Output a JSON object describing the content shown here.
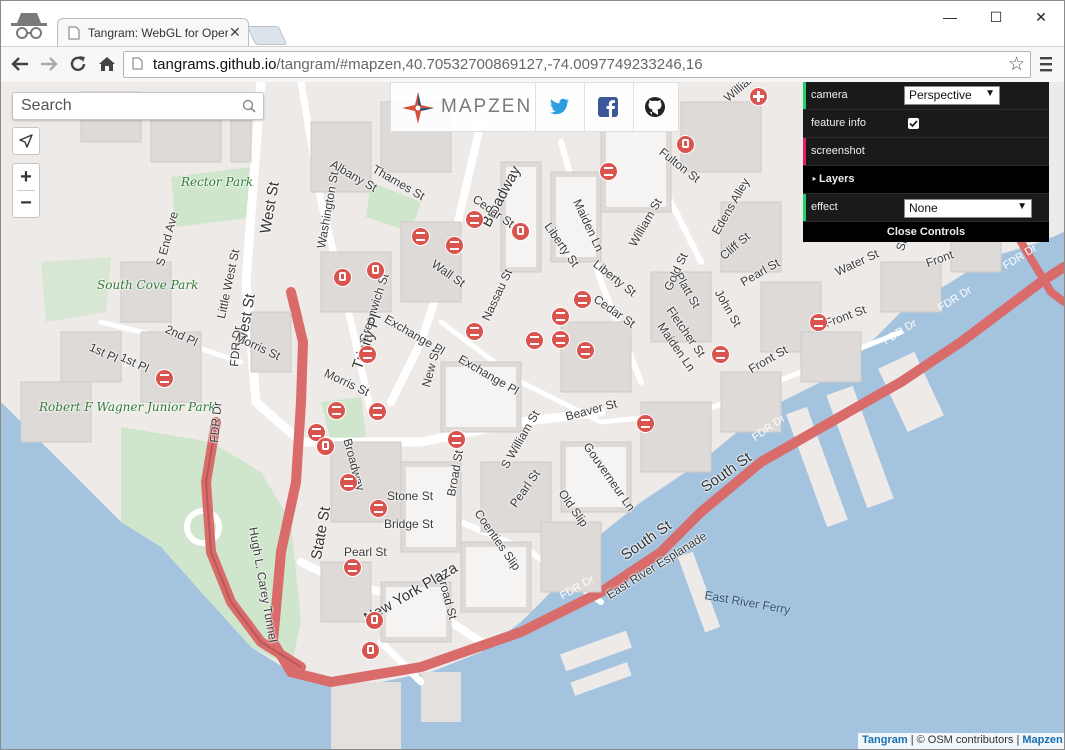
{
  "browser": {
    "tab_title": "Tangram: WebGL for Oper",
    "url_host": "tangrams.github.io",
    "url_path": "/tangram/#mapzen,40.70532700869127,-74.0097749233246,16",
    "window_controls": {
      "minimize": "—",
      "maximize": "☐",
      "close": "✕"
    }
  },
  "map": {
    "search_placeholder": "Search",
    "zoom_in": "+",
    "zoom_out": "−",
    "brand": "MAPZEN",
    "colors": {
      "water": "#a4c3df",
      "land": "#eeeae8",
      "park": "#cfe6cc",
      "highway": "#d96b6b",
      "poi": "#d9534f"
    },
    "labels": {
      "rector_park": "Rector Park",
      "south_cove_park": "South Cove Park",
      "wagner_park": "Robert F Wagner Junior Park",
      "west_st": "West St",
      "west_st_2": "West St",
      "albany_st": "Albany St",
      "thames_st": "Thames St",
      "washington_st": "Washington St",
      "s_end_ave": "S End Ave",
      "little_west_st": "Little West St",
      "fdr_dr_1": "FDR Dr",
      "fdr_dr_2": "FDR Dr",
      "fdr_dr_3": "FDR Dr",
      "fdr_dr_4": "FDR Dr",
      "fdr_dr_5": "FDR Dr",
      "fdr_dr_6": "FDR Dr",
      "fdr_dr_7": "FDR Dr",
      "second_pl": "2nd Pl",
      "first_pl": "1st Pl",
      "first_pl_2": "1st Pl",
      "morris_st": "Morris St",
      "morris_st_2": "Morris St",
      "greenwich_st": "Greenwich St",
      "trinity_pl": "Trinity Pl",
      "broadway": "Broadway",
      "broadway_2": "Broadway",
      "cedar_st": "Cedar St",
      "cedar_st_2": "Cedar St",
      "wall_st": "Wall St",
      "exchange_pl": "Exchange Pl",
      "exchange_pl_2": "Exchange Pl",
      "nassau_st": "Nassau St",
      "new_st": "New St",
      "liberty_st": "Liberty St",
      "liberty_st_2": "Liberty St",
      "maiden_ln": "Maiden Ln",
      "maiden_ln_2": "Maiden Ln",
      "william_st": "William St",
      "william_st_2": "William St",
      "fulton_st": "Fulton St",
      "edens_alley": "Edens Alley",
      "cliff_st": "Cliff St",
      "gold_st": "Gold St",
      "platt_st": "Platt St",
      "john_st": "John St",
      "pearl_st": "Pearl St",
      "pearl_st_2": "Pearl St",
      "pearl_st_3": "Pearl St",
      "fletcher_st": "Fletcher St",
      "water_st": "Water St",
      "front_st": "Front St",
      "front_st_2": "Front St",
      "front_st_3": "Front",
      "beaver_st": "Beaver St",
      "s_william_st": "S William St",
      "gouverneur_ln": "Gouverneur Ln",
      "old_slip": "Old Slip",
      "coenties_slip": "Coenties Slip",
      "stone_st": "Stone St",
      "bridge_st": "Bridge St",
      "broad_st": "Broad St",
      "broad_st_2": "Broad St",
      "state_st": "State St",
      "new_york_plaza": "New York Plaza",
      "south_st": "South St",
      "south_st_2": "South St",
      "east_river_esplanade": "East River Esplanade",
      "east_river_ferry": "East River Ferry",
      "hugh_carey_tunnel": "Hugh L. Carey Tunnel",
      "slip": "Slip",
      "william_partial": "Willian"
    }
  },
  "controls": {
    "camera_label": "camera",
    "camera_value": "Perspective",
    "feature_info_label": "feature info",
    "feature_info_checked": true,
    "screenshot_label": "screenshot",
    "layers_label": "Layers",
    "effect_label": "effect",
    "effect_value": "None",
    "close_label": "Close Controls"
  },
  "attribution": {
    "tangram": "Tangram",
    "osm": "© OSM contributors",
    "mapzen": "Mapzen"
  }
}
